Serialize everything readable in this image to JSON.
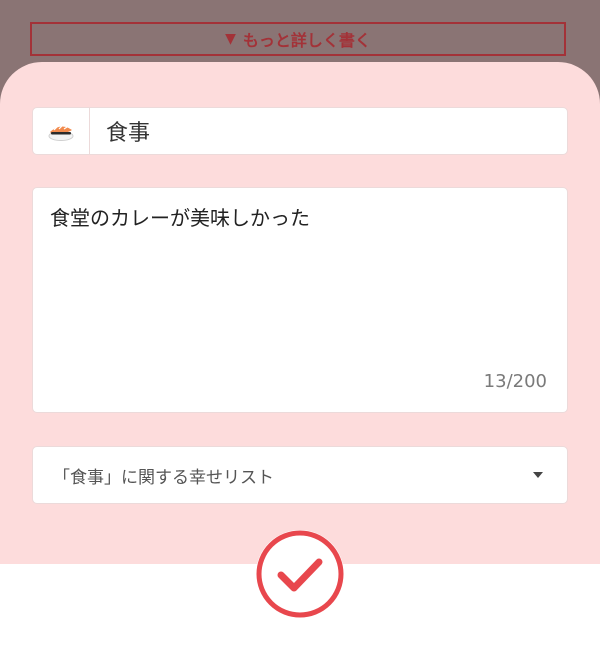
{
  "expand_button": {
    "arrow": "▼",
    "label": "もっと詳しく書く"
  },
  "category": {
    "icon": "sushi-icon",
    "value": "食事"
  },
  "memo": {
    "text": "食堂のカレーが美味しかった",
    "counter": "13/200"
  },
  "happiness_list": {
    "label": "「食事」に関する幸せリスト"
  },
  "confirm": {
    "icon": "checkmark-circle-icon"
  },
  "colors": {
    "accent": "#e8474d",
    "sheet": "#fddcdc",
    "overlay": "#8a7474",
    "expand_text": "#a33238"
  }
}
